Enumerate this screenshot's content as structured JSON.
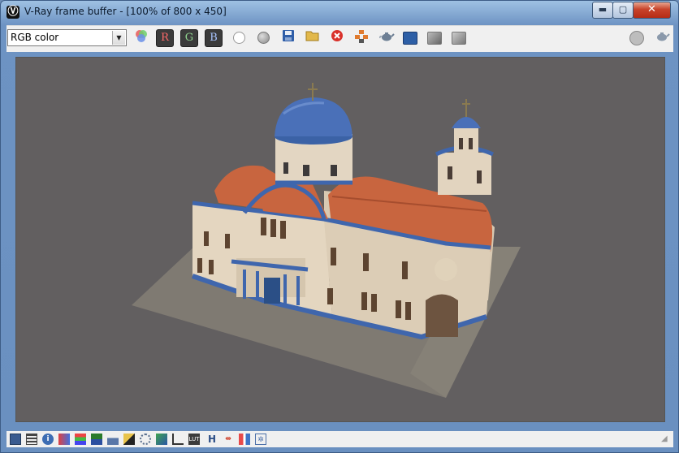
{
  "window": {
    "title": "V-Ray frame buffer - [100% of 800 x 450]",
    "controls": {
      "minimize": "▬",
      "maximize": "▢",
      "close": "✕"
    }
  },
  "toolbar": {
    "channel": "RGB color",
    "channel_buttons": {
      "r": "R",
      "g": "G",
      "b": "B"
    },
    "icons": [
      "rgb-circles-icon",
      "red-channel-icon",
      "green-channel-icon",
      "blue-channel-icon",
      "white-circle-icon",
      "gray-circle-icon",
      "save-icon",
      "open-folder-icon",
      "clear-image-icon",
      "duplicate-icon",
      "render-teapot-icon",
      "lut-compare-icon",
      "image-icon",
      "history-icon",
      "stop-icon",
      "teapot-icon"
    ]
  },
  "colors": {
    "viewport_bg": "#625f60",
    "dome_blue": "#4a70b8",
    "roof_terracotta": "#c8653f",
    "wall_cream": "#e4d6c0",
    "red_channel": "#e85a5a",
    "green_channel": "#8fd48f",
    "blue_channel": "#8fb3ff"
  },
  "statusbar": {
    "icons": [
      "color-corrections-icon",
      "lut-icon",
      "info-icon",
      "color-balance-icon",
      "levels-icon",
      "curves-icon",
      "histogram-icon",
      "exposure-icon",
      "pixel-aspect-icon",
      "tone-icon",
      "srgb-icon",
      "lut-file-icon",
      "hsv-icon",
      "levels-h-icon",
      "compare-icon",
      "stamp-icon"
    ],
    "labels": {
      "lut": "LUT",
      "h": "H"
    }
  }
}
